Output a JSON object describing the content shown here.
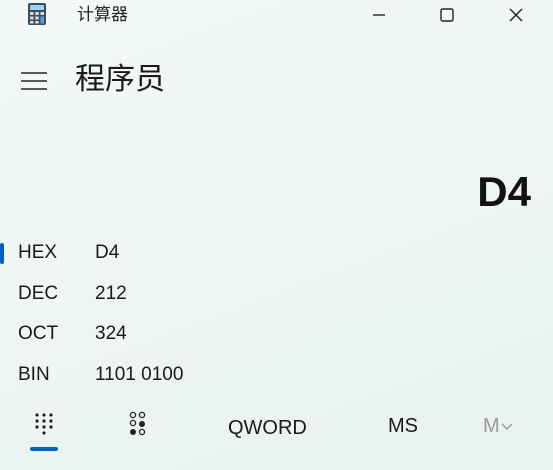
{
  "window": {
    "title": "计算器",
    "controls": [
      "minimize-icon",
      "maximize-icon",
      "close-icon"
    ]
  },
  "header": {
    "menu_icon": "hamburger-icon",
    "mode_title": "程序员"
  },
  "display": {
    "value": "D4"
  },
  "radix": [
    {
      "name": "HEX",
      "value": "D4",
      "selected": true
    },
    {
      "name": "DEC",
      "value": "212",
      "selected": false
    },
    {
      "name": "OCT",
      "value": "324",
      "selected": false
    },
    {
      "name": "BIN",
      "value": "1101 0100",
      "selected": false
    }
  ],
  "toolbar": {
    "keypad_icon": "full-keypad-icon",
    "bits_icon": "bit-toggling-keypad-icon",
    "word_size": "QWORD",
    "memory_store": "MS",
    "memory_view": "M",
    "accent_color": "#0063c2"
  }
}
